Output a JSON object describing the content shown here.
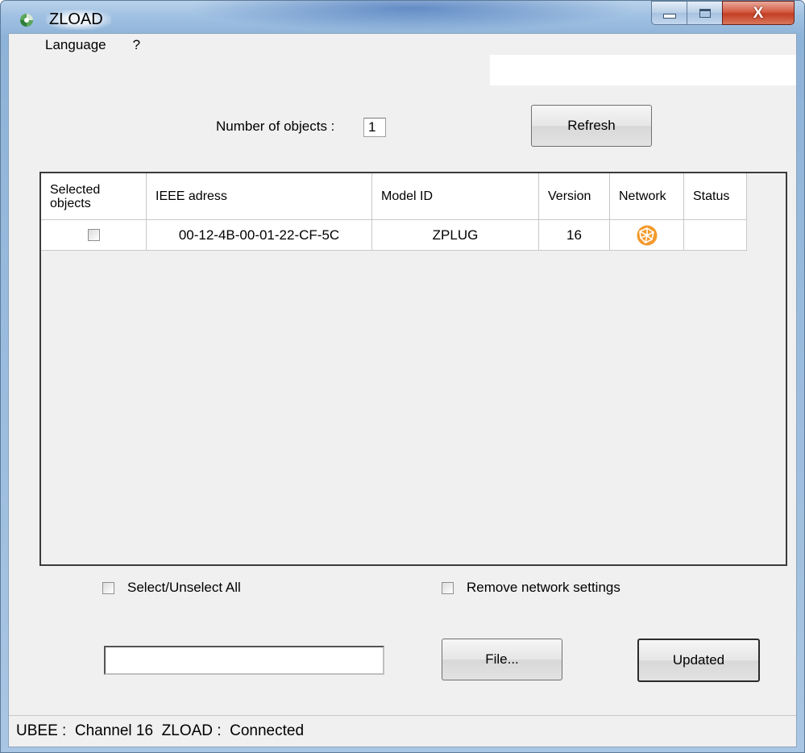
{
  "window": {
    "title": "ZLOAD"
  },
  "menu": {
    "items": [
      "Language",
      "?"
    ]
  },
  "header": {
    "count_label": "Number of objects :",
    "count_value": "1",
    "refresh_label": "Refresh"
  },
  "table": {
    "columns": [
      "Selected\nobjects",
      "IEEE adress",
      "Model ID",
      "Version",
      "Network",
      "Status"
    ],
    "rows": [
      {
        "selected": false,
        "ieee": "00-12-4B-00-01-22-CF-5C",
        "model": "ZPLUG",
        "version": "16",
        "network_icon": "zigbee-network-icon",
        "status": ""
      }
    ]
  },
  "options": {
    "select_all_label": "Select/Unselect All",
    "select_all_checked": false,
    "remove_label": "Remove network settings",
    "remove_checked": false
  },
  "actions": {
    "file_path": "",
    "file_label": "File...",
    "update_label": "Updated"
  },
  "status": {
    "ubee_label": "UBEE :",
    "channel": "Channel 16",
    "zload_label": "ZLOAD :",
    "state": "Connected"
  },
  "colors": {
    "network_icon": "#f39a2c",
    "close_button": "#c94a30"
  }
}
